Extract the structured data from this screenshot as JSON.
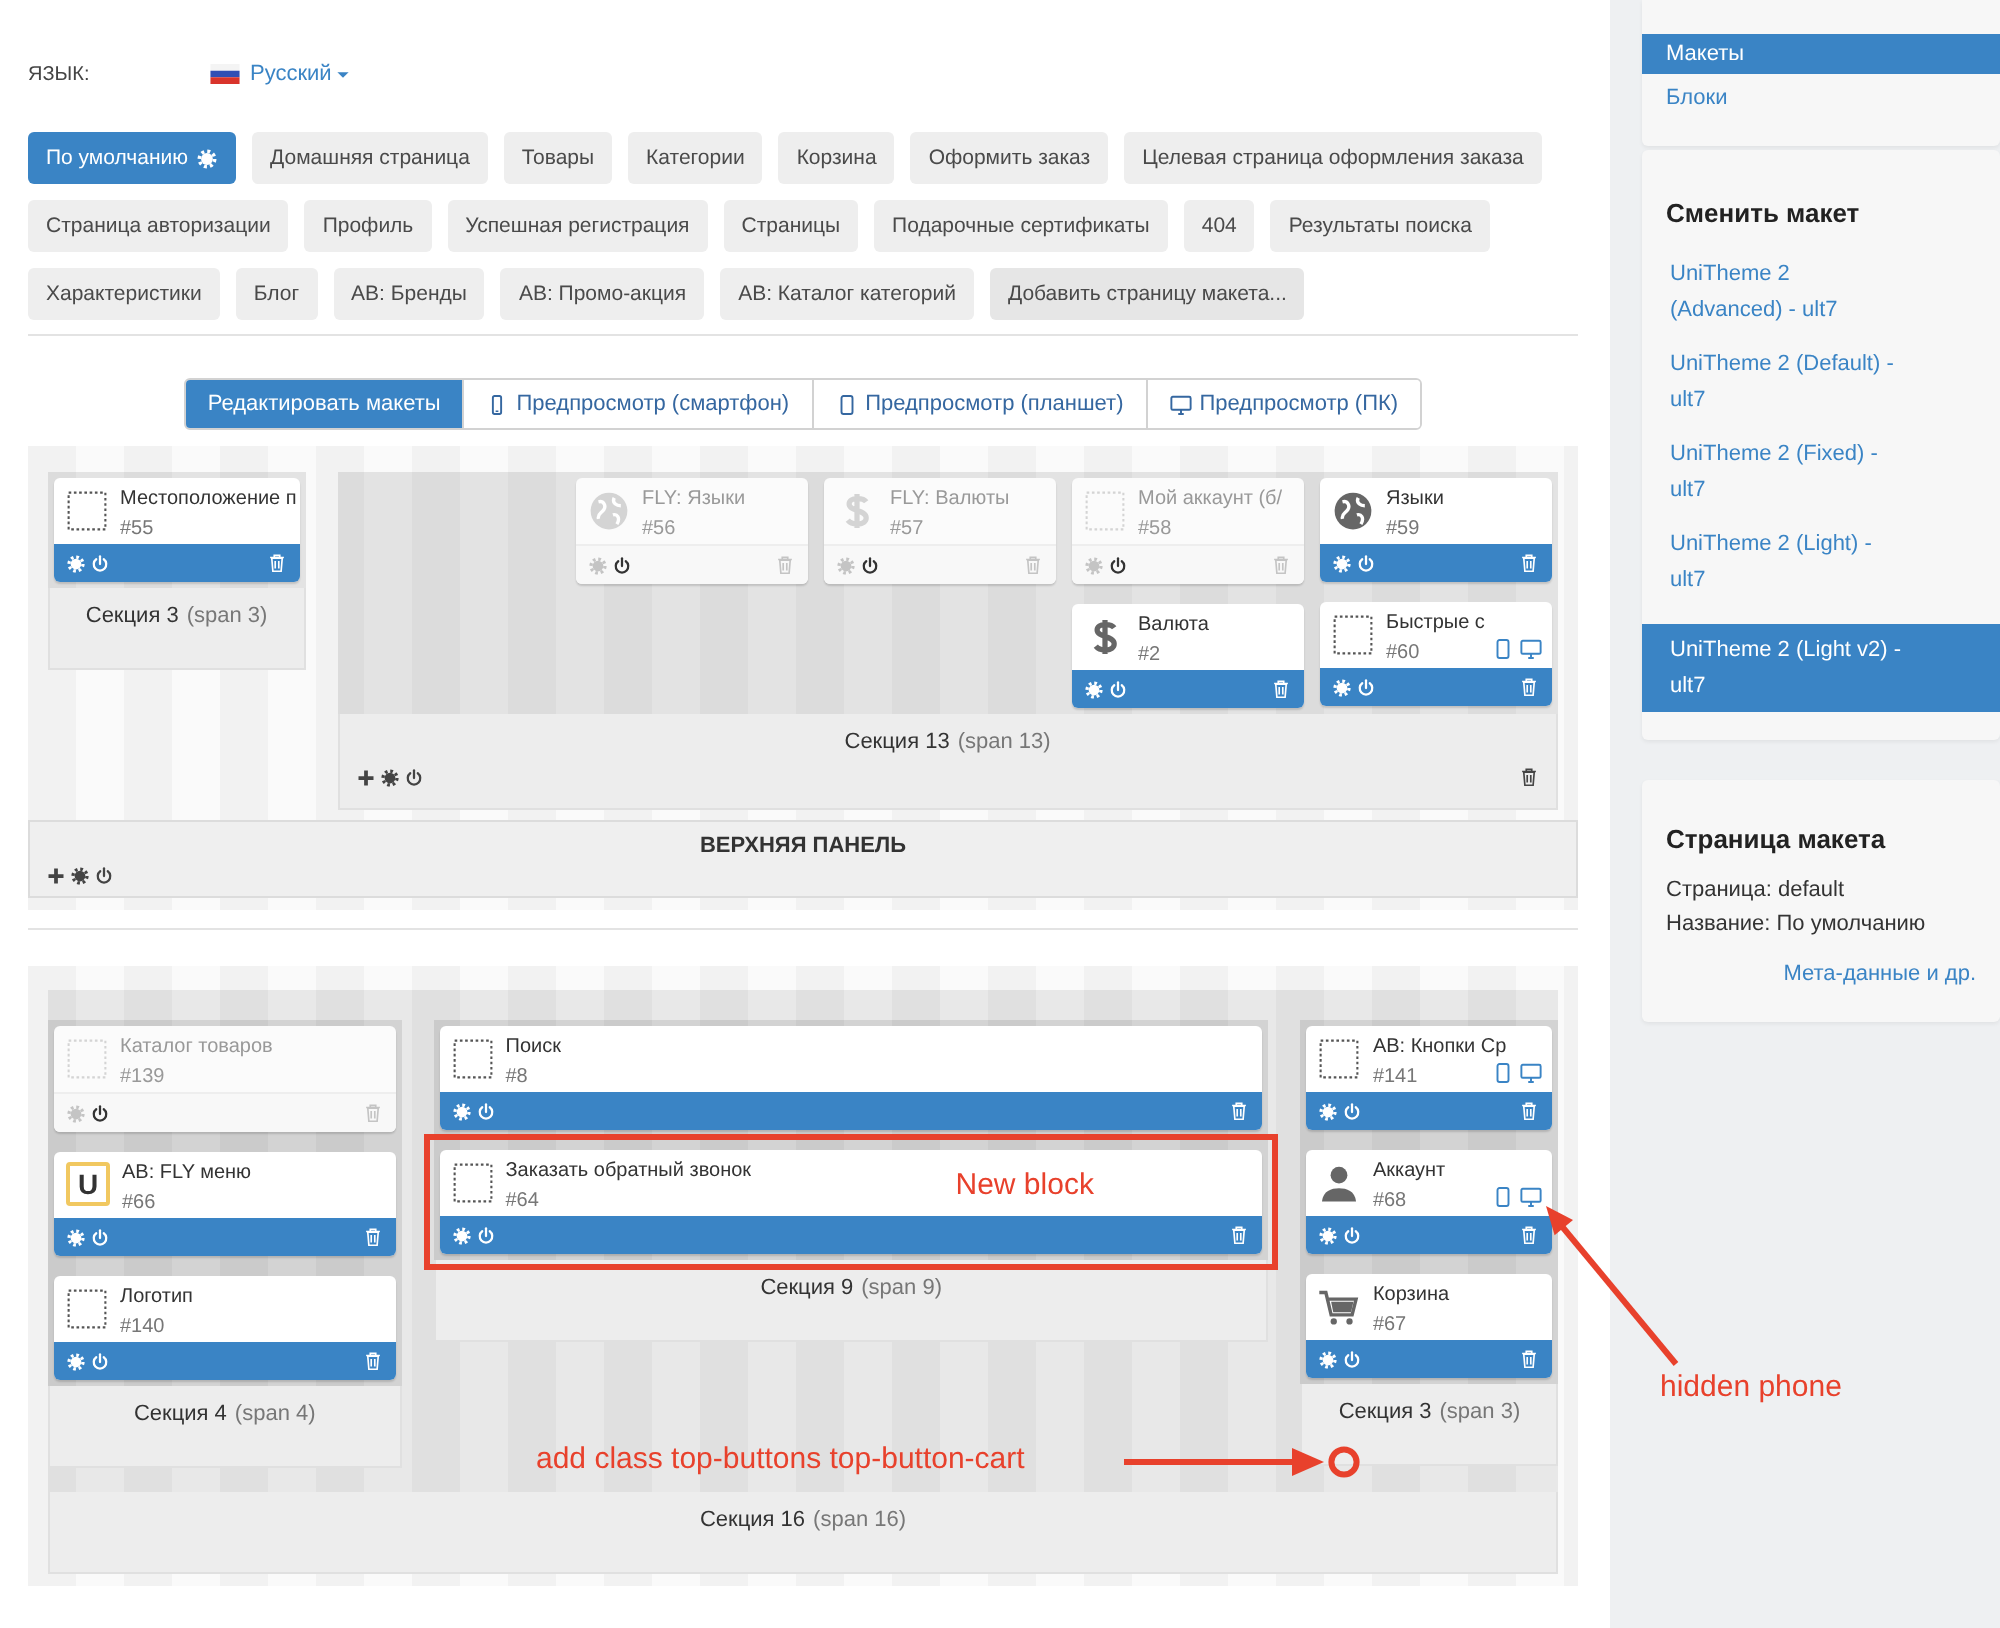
{
  "language": {
    "label": "ЯЗЫК:",
    "value": "Русский"
  },
  "page_tabs": [
    {
      "label": "По умолчанию",
      "selected": true,
      "kind": "settings"
    },
    {
      "label": "Домашняя страница",
      "selected": false,
      "kind": "page"
    },
    {
      "label": "Товары",
      "selected": false,
      "kind": "page"
    },
    {
      "label": "Категории",
      "selected": false,
      "kind": "page"
    },
    {
      "label": "Корзина",
      "selected": false,
      "kind": "page"
    },
    {
      "label": "Оформить заказ",
      "selected": false,
      "kind": "page"
    },
    {
      "label": "Целевая страница оформления заказа",
      "selected": false,
      "kind": "page"
    },
    {
      "label": "Страница авторизации",
      "selected": false,
      "kind": "page"
    },
    {
      "label": "Профиль",
      "selected": false,
      "kind": "page"
    },
    {
      "label": "Успешная регистрация",
      "selected": false,
      "kind": "page"
    },
    {
      "label": "Страницы",
      "selected": false,
      "kind": "page"
    },
    {
      "label": "Подарочные сертификаты",
      "selected": false,
      "kind": "page"
    },
    {
      "label": "404",
      "selected": false,
      "kind": "page"
    },
    {
      "label": "Результаты поиска",
      "selected": false,
      "kind": "page"
    },
    {
      "label": "Характеристики",
      "selected": false,
      "kind": "page"
    },
    {
      "label": "Блог",
      "selected": false,
      "kind": "page"
    },
    {
      "label": "АВ: Бренды",
      "selected": false,
      "kind": "page"
    },
    {
      "label": "АВ: Промо-акция",
      "selected": false,
      "kind": "page"
    },
    {
      "label": "АВ: Каталог категорий",
      "selected": false,
      "kind": "page"
    },
    {
      "label": "Добавить страницу макета...",
      "selected": false,
      "kind": "add"
    }
  ],
  "mode_tabs": [
    {
      "label": "Редактировать макеты",
      "selected": true,
      "kind": "edit"
    },
    {
      "label": "Предпросмотр (смартфон)",
      "selected": false,
      "kind": "phone"
    },
    {
      "label": "Предпросмотр (планшет)",
      "selected": false,
      "kind": "tablet"
    },
    {
      "label": "Предпросмотр (ПК)",
      "selected": false,
      "kind": "desktop"
    }
  ],
  "containers": [
    {
      "title": "ВЕРХНЯЯ ПАНЕЛЬ",
      "tools": true,
      "sections": [
        {
          "name": "Секция 3",
          "span_label": "(span 3)",
          "columns": [
            [
              {
                "name": "Местоположение п",
                "id": "#55",
                "kind": "placeholder",
                "enabled": true
              }
            ]
          ]
        },
        {
          "name": "Секция 13",
          "span_label": "(span 13)",
          "tools": true,
          "columns": [
            [
              {
                "name": "FLY: Языки",
                "id": "#56",
                "kind": "globe",
                "enabled": false
              }
            ],
            [
              {
                "name": "FLY: Валюты",
                "id": "#57",
                "kind": "dollar",
                "enabled": false
              }
            ],
            [
              {
                "name": "Мой аккаунт (б/",
                "id": "#58",
                "kind": "placeholder",
                "enabled": false
              },
              {
                "name": "Валюта",
                "id": "#2",
                "kind": "dollar",
                "enabled": true
              }
            ],
            [
              {
                "name": "Языки",
                "id": "#59",
                "kind": "globe",
                "enabled": true
              },
              {
                "name": "Быстрые с",
                "id": "#60",
                "kind": "placeholder",
                "enabled": true,
                "devices": true
              }
            ]
          ]
        }
      ]
    },
    {
      "sections": [
        {
          "name": "Секция 16",
          "span_label": "(span 16)",
          "children": [
            {
              "name": "Секция 4",
              "span_label": "(span 4)",
              "columns": [
                [
                  {
                    "name": "Каталог товаров",
                    "id": "#139",
                    "kind": "placeholder",
                    "enabled": false
                  },
                  {
                    "name": "АВ: FLY меню",
                    "id": "#66",
                    "kind": "letter",
                    "icon_text": "U",
                    "enabled": true
                  },
                  {
                    "name": "Логотип",
                    "id": "#140",
                    "kind": "placeholder",
                    "enabled": true
                  }
                ]
              ]
            },
            {
              "name": "Секция 9",
              "span_label": "(span 9)",
              "columns": [
                [
                  {
                    "name": "Поиск",
                    "id": "#8",
                    "kind": "placeholder",
                    "enabled": true
                  },
                  {
                    "name": "Заказать обратный звонок",
                    "id": "#64",
                    "kind": "placeholder",
                    "enabled": true,
                    "highlight": true,
                    "note": "New block"
                  }
                ]
              ]
            },
            {
              "name": "Секция 3",
              "span_label": "(span 3)",
              "columns": [
                [
                  {
                    "name": "АВ: Кнопки Ср",
                    "id": "#141",
                    "kind": "placeholder",
                    "enabled": true,
                    "devices": true
                  },
                  {
                    "name": "Аккаунт",
                    "id": "#68",
                    "kind": "person",
                    "enabled": true,
                    "devices": true
                  },
                  {
                    "name": "Корзина",
                    "id": "#67",
                    "kind": "cart",
                    "enabled": true
                  }
                ]
              ]
            }
          ]
        }
      ]
    }
  ],
  "annotations": [
    {
      "kind": "arrow-callout",
      "text": "hidden phone"
    },
    {
      "kind": "circle-callout",
      "text": "add class top-buttons top-button-cart"
    }
  ],
  "sidebar": {
    "nav": [
      {
        "label": "Макеты",
        "selected": true
      },
      {
        "label": "Блоки",
        "selected": false
      }
    ],
    "layouts": {
      "title": "Сменить макет",
      "items": [
        {
          "label": "UniTheme 2 (Advanced) - ult7",
          "selected": false
        },
        {
          "label": "UniTheme 2 (Default) - ult7",
          "selected": false
        },
        {
          "label": "UniTheme 2 (Fixed) - ult7",
          "selected": false
        },
        {
          "label": "UniTheme 2 (Light) - ult7",
          "selected": false
        },
        {
          "label": "UniTheme 2 (Light v2) - ult7",
          "selected": true
        }
      ]
    },
    "page_info": {
      "title": "Страница макета",
      "lines": [
        "Страница: default",
        "Название: По умолчанию"
      ],
      "link": "Мета-данные и др."
    }
  }
}
